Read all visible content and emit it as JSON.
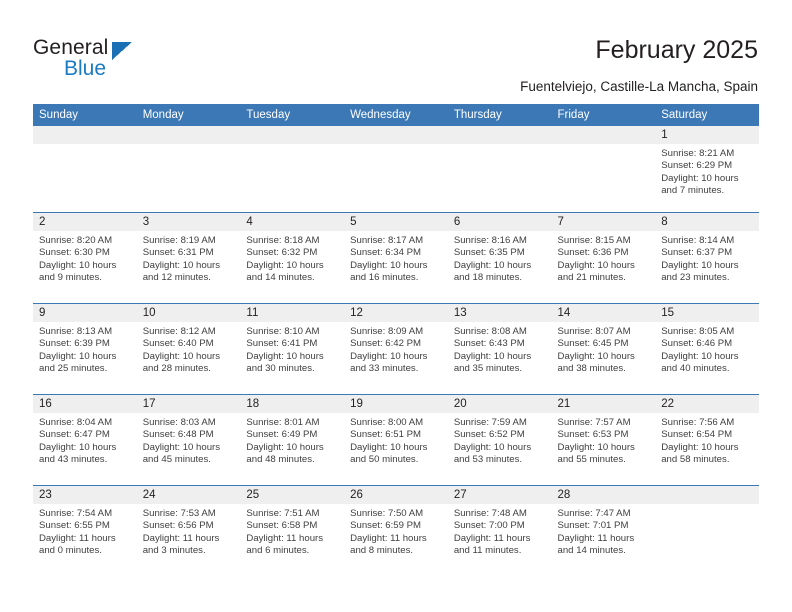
{
  "brand": {
    "name_top": "General",
    "name_bottom": "Blue",
    "accent_color": "#1b7bc4",
    "triangle_icon": "brand-triangle-icon"
  },
  "header": {
    "title": "February 2025",
    "subtitle": "Fuentelviejo, Castille-La Mancha, Spain"
  },
  "calendar": {
    "header_bg": "#3b78b5",
    "daynum_band_bg": "#efeff0",
    "weekdays": [
      "Sunday",
      "Monday",
      "Tuesday",
      "Wednesday",
      "Thursday",
      "Friday",
      "Saturday"
    ],
    "weeks": [
      [
        {
          "day": ""
        },
        {
          "day": ""
        },
        {
          "day": ""
        },
        {
          "day": ""
        },
        {
          "day": ""
        },
        {
          "day": ""
        },
        {
          "day": "1",
          "sunrise": "Sunrise: 8:21 AM",
          "sunset": "Sunset: 6:29 PM",
          "daylight": "Daylight: 10 hours and 7 minutes."
        }
      ],
      [
        {
          "day": "2",
          "sunrise": "Sunrise: 8:20 AM",
          "sunset": "Sunset: 6:30 PM",
          "daylight": "Daylight: 10 hours and 9 minutes."
        },
        {
          "day": "3",
          "sunrise": "Sunrise: 8:19 AM",
          "sunset": "Sunset: 6:31 PM",
          "daylight": "Daylight: 10 hours and 12 minutes."
        },
        {
          "day": "4",
          "sunrise": "Sunrise: 8:18 AM",
          "sunset": "Sunset: 6:32 PM",
          "daylight": "Daylight: 10 hours and 14 minutes."
        },
        {
          "day": "5",
          "sunrise": "Sunrise: 8:17 AM",
          "sunset": "Sunset: 6:34 PM",
          "daylight": "Daylight: 10 hours and 16 minutes."
        },
        {
          "day": "6",
          "sunrise": "Sunrise: 8:16 AM",
          "sunset": "Sunset: 6:35 PM",
          "daylight": "Daylight: 10 hours and 18 minutes."
        },
        {
          "day": "7",
          "sunrise": "Sunrise: 8:15 AM",
          "sunset": "Sunset: 6:36 PM",
          "daylight": "Daylight: 10 hours and 21 minutes."
        },
        {
          "day": "8",
          "sunrise": "Sunrise: 8:14 AM",
          "sunset": "Sunset: 6:37 PM",
          "daylight": "Daylight: 10 hours and 23 minutes."
        }
      ],
      [
        {
          "day": "9",
          "sunrise": "Sunrise: 8:13 AM",
          "sunset": "Sunset: 6:39 PM",
          "daylight": "Daylight: 10 hours and 25 minutes."
        },
        {
          "day": "10",
          "sunrise": "Sunrise: 8:12 AM",
          "sunset": "Sunset: 6:40 PM",
          "daylight": "Daylight: 10 hours and 28 minutes."
        },
        {
          "day": "11",
          "sunrise": "Sunrise: 8:10 AM",
          "sunset": "Sunset: 6:41 PM",
          "daylight": "Daylight: 10 hours and 30 minutes."
        },
        {
          "day": "12",
          "sunrise": "Sunrise: 8:09 AM",
          "sunset": "Sunset: 6:42 PM",
          "daylight": "Daylight: 10 hours and 33 minutes."
        },
        {
          "day": "13",
          "sunrise": "Sunrise: 8:08 AM",
          "sunset": "Sunset: 6:43 PM",
          "daylight": "Daylight: 10 hours and 35 minutes."
        },
        {
          "day": "14",
          "sunrise": "Sunrise: 8:07 AM",
          "sunset": "Sunset: 6:45 PM",
          "daylight": "Daylight: 10 hours and 38 minutes."
        },
        {
          "day": "15",
          "sunrise": "Sunrise: 8:05 AM",
          "sunset": "Sunset: 6:46 PM",
          "daylight": "Daylight: 10 hours and 40 minutes."
        }
      ],
      [
        {
          "day": "16",
          "sunrise": "Sunrise: 8:04 AM",
          "sunset": "Sunset: 6:47 PM",
          "daylight": "Daylight: 10 hours and 43 minutes."
        },
        {
          "day": "17",
          "sunrise": "Sunrise: 8:03 AM",
          "sunset": "Sunset: 6:48 PM",
          "daylight": "Daylight: 10 hours and 45 minutes."
        },
        {
          "day": "18",
          "sunrise": "Sunrise: 8:01 AM",
          "sunset": "Sunset: 6:49 PM",
          "daylight": "Daylight: 10 hours and 48 minutes."
        },
        {
          "day": "19",
          "sunrise": "Sunrise: 8:00 AM",
          "sunset": "Sunset: 6:51 PM",
          "daylight": "Daylight: 10 hours and 50 minutes."
        },
        {
          "day": "20",
          "sunrise": "Sunrise: 7:59 AM",
          "sunset": "Sunset: 6:52 PM",
          "daylight": "Daylight: 10 hours and 53 minutes."
        },
        {
          "day": "21",
          "sunrise": "Sunrise: 7:57 AM",
          "sunset": "Sunset: 6:53 PM",
          "daylight": "Daylight: 10 hours and 55 minutes."
        },
        {
          "day": "22",
          "sunrise": "Sunrise: 7:56 AM",
          "sunset": "Sunset: 6:54 PM",
          "daylight": "Daylight: 10 hours and 58 minutes."
        }
      ],
      [
        {
          "day": "23",
          "sunrise": "Sunrise: 7:54 AM",
          "sunset": "Sunset: 6:55 PM",
          "daylight": "Daylight: 11 hours and 0 minutes."
        },
        {
          "day": "24",
          "sunrise": "Sunrise: 7:53 AM",
          "sunset": "Sunset: 6:56 PM",
          "daylight": "Daylight: 11 hours and 3 minutes."
        },
        {
          "day": "25",
          "sunrise": "Sunrise: 7:51 AM",
          "sunset": "Sunset: 6:58 PM",
          "daylight": "Daylight: 11 hours and 6 minutes."
        },
        {
          "day": "26",
          "sunrise": "Sunrise: 7:50 AM",
          "sunset": "Sunset: 6:59 PM",
          "daylight": "Daylight: 11 hours and 8 minutes."
        },
        {
          "day": "27",
          "sunrise": "Sunrise: 7:48 AM",
          "sunset": "Sunset: 7:00 PM",
          "daylight": "Daylight: 11 hours and 11 minutes."
        },
        {
          "day": "28",
          "sunrise": "Sunrise: 7:47 AM",
          "sunset": "Sunset: 7:01 PM",
          "daylight": "Daylight: 11 hours and 14 minutes."
        },
        {
          "day": ""
        }
      ]
    ]
  }
}
